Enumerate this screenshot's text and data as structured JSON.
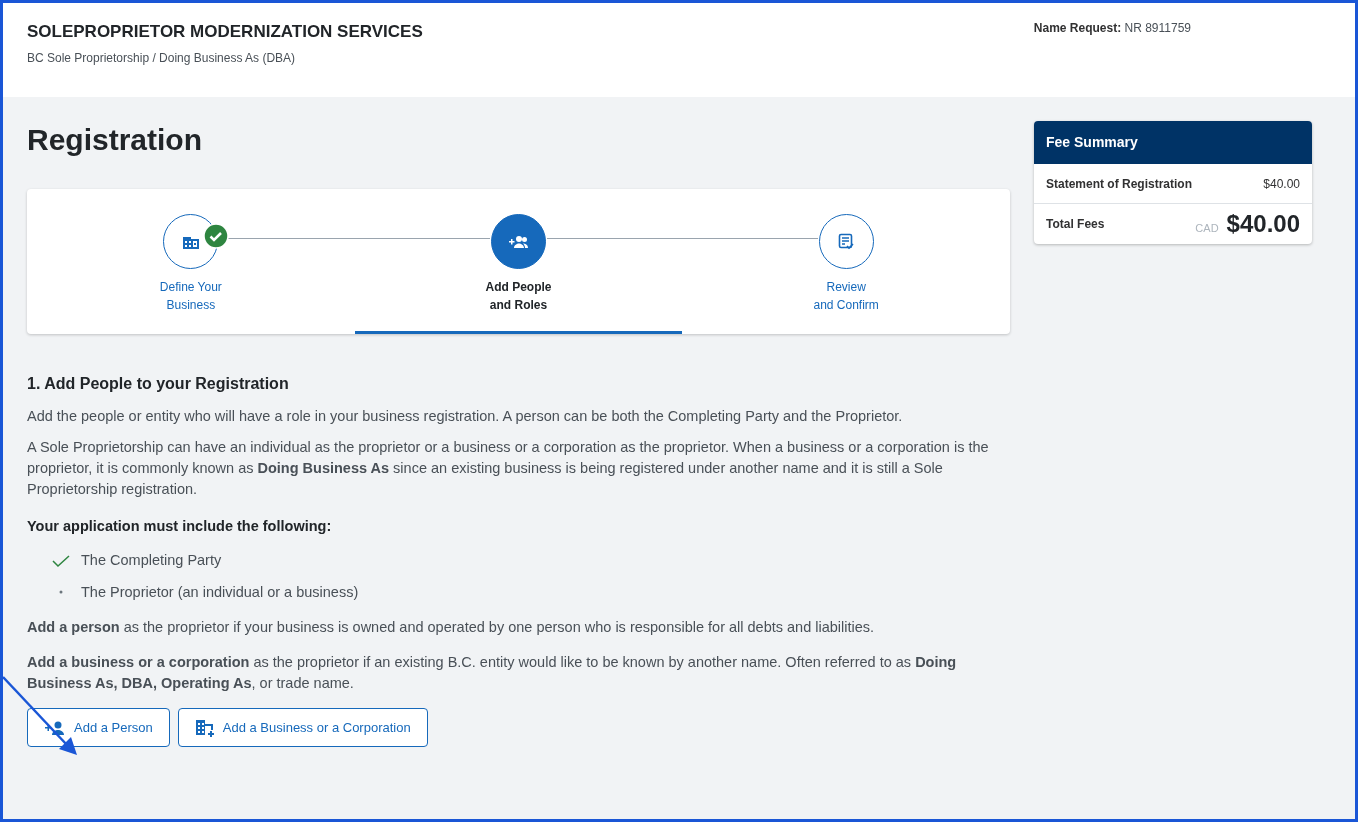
{
  "header": {
    "title": "SOLEPROPRIETOR MODERNIZATION SERVICES",
    "subtitle": "BC Sole Proprietorship / Doing Business As (DBA)",
    "name_request_label": "Name Request:",
    "name_request_value": "NR 8911759"
  },
  "page_title": "Registration",
  "steps": [
    {
      "label_line1": "Define Your",
      "label_line2": "Business",
      "selected": false,
      "completed": true
    },
    {
      "label_line1": "Add People",
      "label_line2": "and Roles",
      "selected": true,
      "completed": false
    },
    {
      "label_line1": "Review",
      "label_line2": "and Confirm",
      "selected": false,
      "completed": false
    }
  ],
  "section": {
    "heading": "1. Add People to your Registration",
    "paragraphs": [
      "Add the people or entity who will have a role in your business registration. A person can be both the Completing Party and the Proprietor.",
      "A Sole Proprietorship can have an individual as the proprietor or a business or a corporation as the proprietor. When a business or a corporation is the proprietor, it is commonly known as **Doing Business As** since an existing business is being registered under another name and it is still a Sole Proprietorship registration."
    ],
    "requirements_heading": "Your application must include the following:",
    "requirements": [
      {
        "text": "The Completing Party",
        "met": true
      },
      {
        "text": "The Proprietor (an individual or a business)",
        "met": false
      }
    ],
    "notes": [
      "**Add a person** as the proprietor if your business is owned and operated by one person who is responsible for all debts and liabilities.",
      "**Add a business or a corporation** as the proprietor if an existing B.C. entity would like to be known by another name. Often referred to as **Doing Business As, DBA, Operating As**, or trade name."
    ],
    "buttons": [
      {
        "label": "Add a Person"
      },
      {
        "label": "Add a Business or a Corporation"
      }
    ]
  },
  "fee_summary": {
    "title": "Fee Summary",
    "items": [
      {
        "label": "Statement of Registration",
        "amount": "$40.00"
      }
    ],
    "total_label": "Total Fees",
    "currency": "CAD",
    "total": "$40.00"
  }
}
